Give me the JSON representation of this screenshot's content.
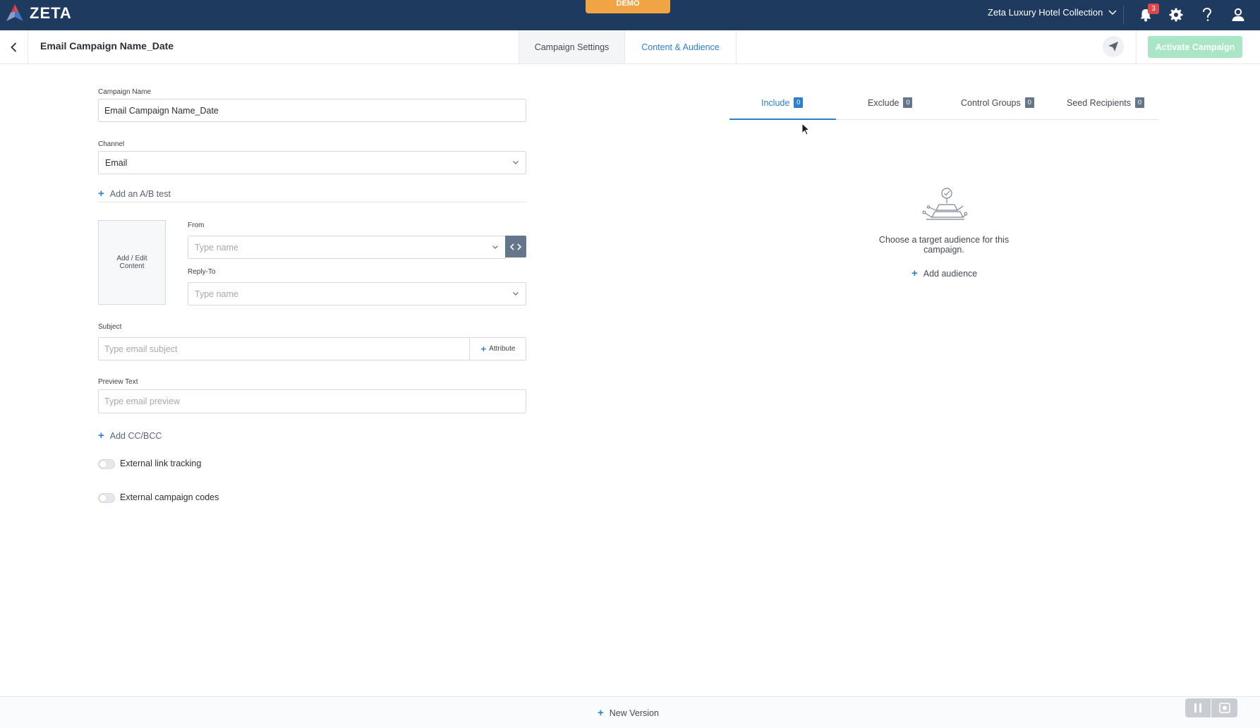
{
  "topbar": {
    "logo_text": "ZETA",
    "demo_label": "DEMO",
    "org_name": "Zeta Luxury Hotel Collection",
    "notification_count": "3",
    "brand_color": "#1f3a5f"
  },
  "subheader": {
    "title": "Email Campaign Name_Date",
    "tabs": [
      {
        "label": "Campaign Settings",
        "active": false
      },
      {
        "label": "Content & Audience",
        "active": true
      }
    ],
    "activate_label": "Activate Campaign"
  },
  "form": {
    "campaign_name": {
      "label": "Campaign Name",
      "value": "Email Campaign Name_Date"
    },
    "channel": {
      "label": "Channel",
      "value": "Email"
    },
    "ab_test_label": "Add an A/B test",
    "content_box_label": "Add / Edit Content",
    "from": {
      "label": "From",
      "placeholder": "Type name"
    },
    "reply_to": {
      "label": "Reply-To",
      "placeholder": "Type name"
    },
    "subject": {
      "label": "Subject",
      "placeholder": "Type email subject",
      "attribute_label": "Attribute"
    },
    "preview_text": {
      "label": "Preview Text",
      "placeholder": "Type email preview"
    },
    "cc_bcc_label": "Add CC/BCC",
    "toggles": [
      {
        "label": "External link tracking",
        "on": false
      },
      {
        "label": "External campaign codes",
        "on": false
      }
    ]
  },
  "audience": {
    "tabs": [
      {
        "label": "Include",
        "count": "0",
        "active": true
      },
      {
        "label": "Exclude",
        "count": "0",
        "active": false
      },
      {
        "label": "Control Groups",
        "count": "0",
        "active": false
      },
      {
        "label": "Seed Recipients",
        "count": "0",
        "active": false
      }
    ],
    "empty_message": "Choose a target audience for this campaign.",
    "add_label": "Add audience"
  },
  "footer": {
    "new_version_label": "New Version"
  },
  "colors": {
    "accent": "#2d7fd0",
    "activate_disabled": "#a9e6c6",
    "demo_badge": "#f0a444",
    "notification": "#e0474c"
  }
}
